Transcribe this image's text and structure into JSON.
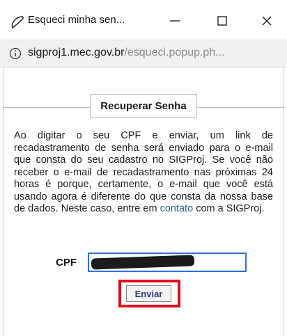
{
  "window": {
    "title": "Esqueci minha sen...",
    "minimize_icon": "minimize-icon",
    "maximize_icon": "maximize-icon",
    "close_icon": "close-icon"
  },
  "address_bar": {
    "icon": "info-icon",
    "host": "sigproj1.mec.gov.br",
    "path": "/esqueci.popup.ph..."
  },
  "form": {
    "legend": "Recuperar Senha",
    "description_text": "Ao digitar o seu CPF e enviar, um link de recadastramento de senha será enviado para o e-mail que consta do seu cadastro no SIGProj. Se você não receber o e-mail de recadastramento nas próximas 24 horas é porque, certamente, o e-mail que você está usando agora é diferente do que consta da nossa base de dados. Neste caso, entre em",
    "contact_link": "contato",
    "description_suffix": "com a SIGProj.",
    "cpf_label": "CPF",
    "cpf_value": "",
    "submit_label": "Enviar"
  },
  "colors": {
    "highlight": "#e00d1f",
    "link": "#2a5db0",
    "input_focus": "#2f6fdc"
  }
}
